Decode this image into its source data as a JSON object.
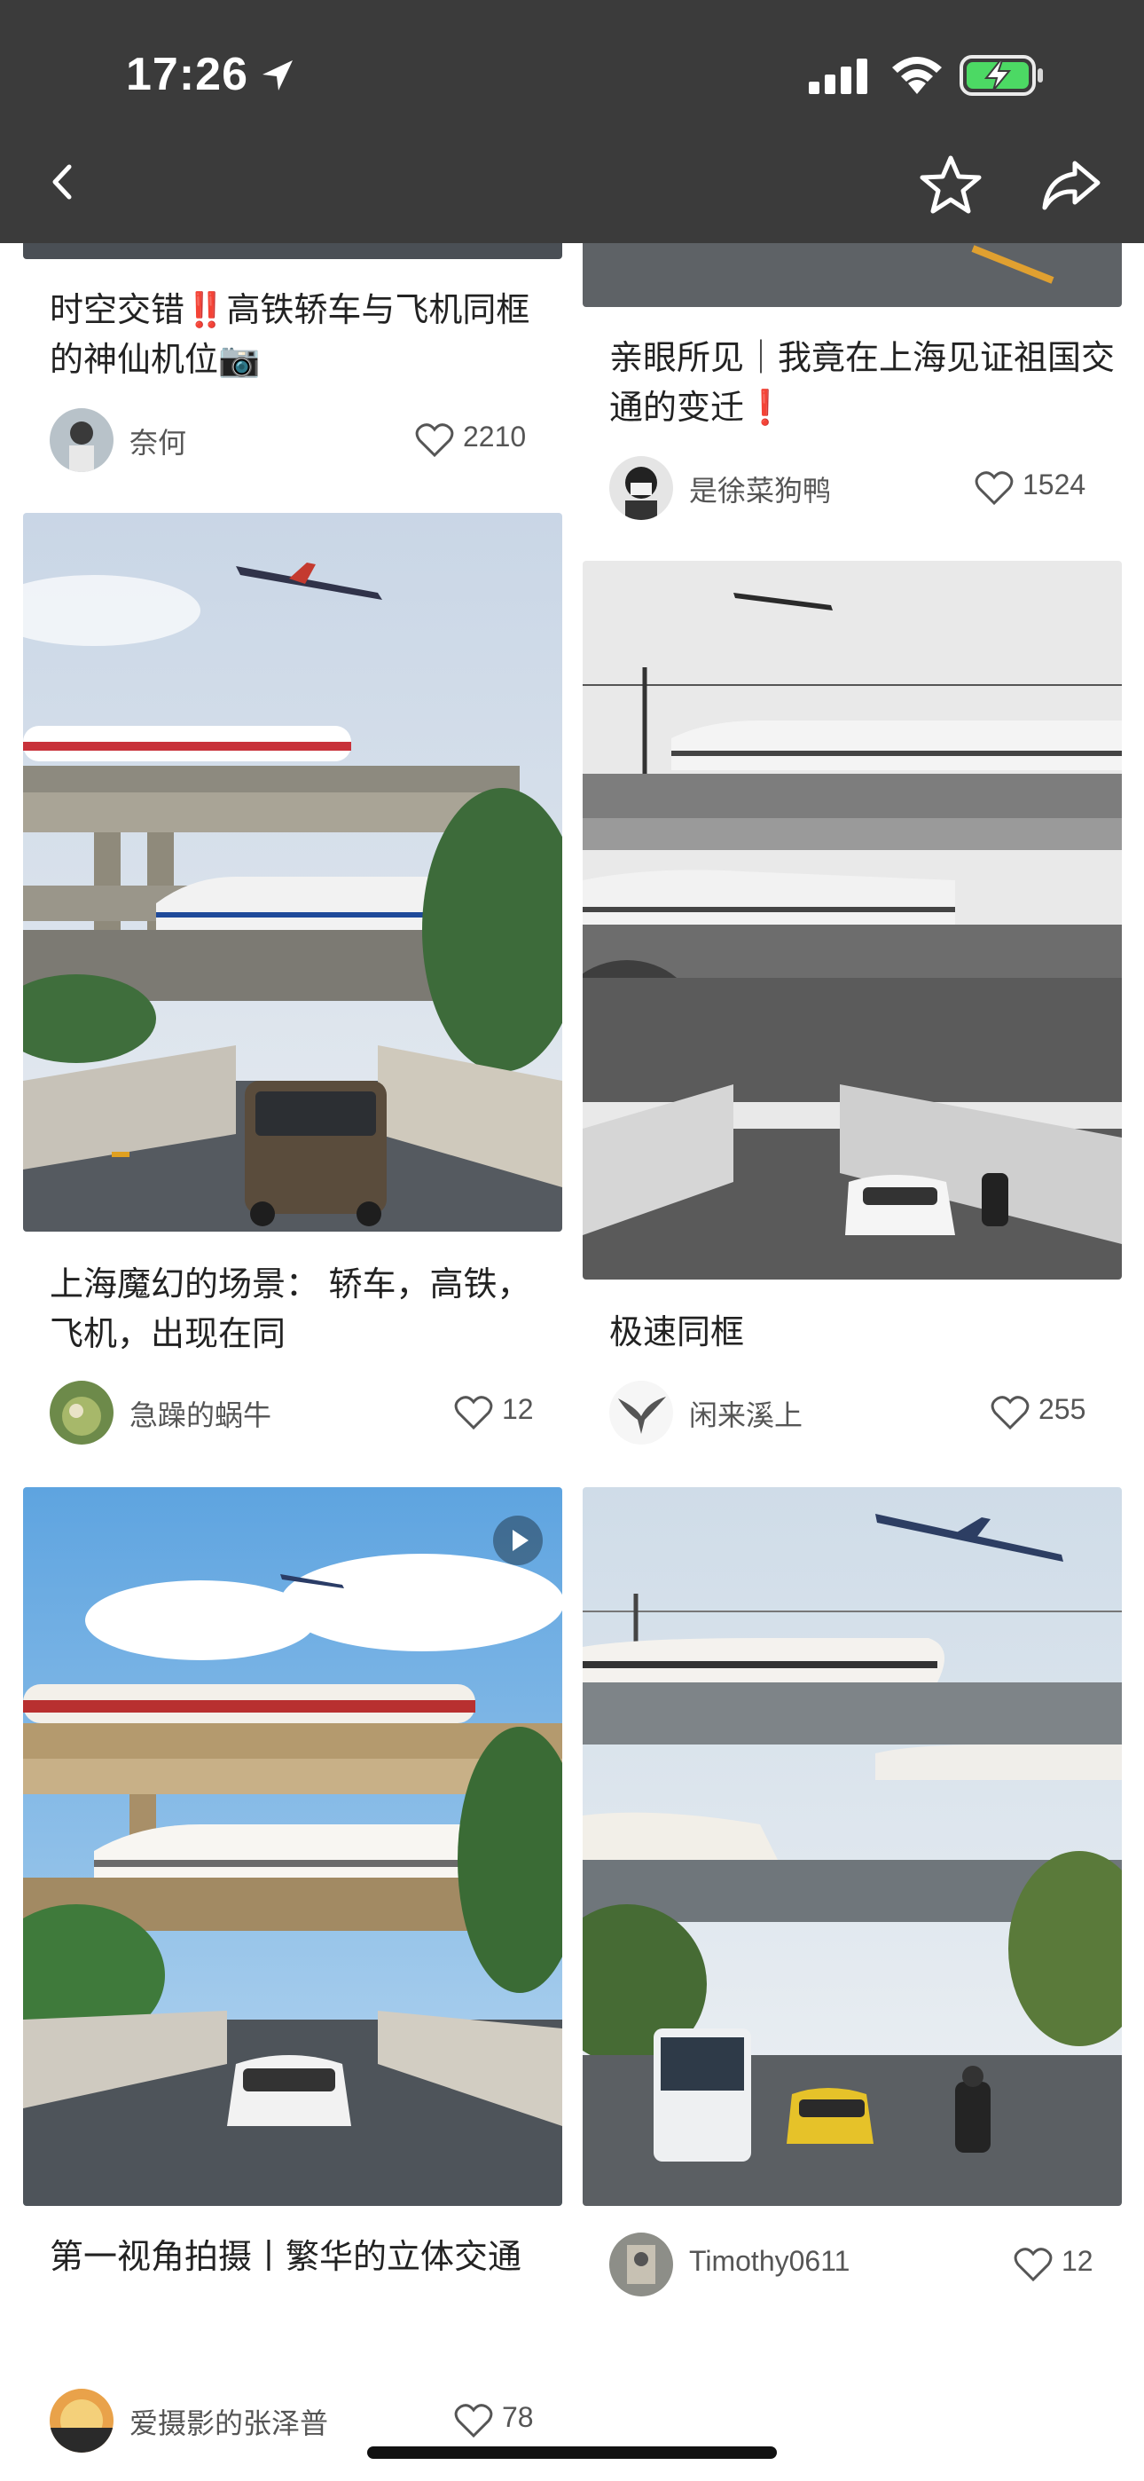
{
  "status_bar": {
    "time": "17:26"
  },
  "nav": {
    "back_icon": "chevron-left-icon",
    "favorite_icon": "star-icon",
    "share_icon": "share-icon"
  },
  "cards": [
    {
      "title_pre": "时空交错",
      "title_mark": "‼️",
      "title_post": "高铁轿车与飞机同框的神仙机位📷",
      "author": "奈何",
      "likes": "2210"
    },
    {
      "title_pre": "亲眼所见｜我竟在上海见证祖国交通的变迁",
      "title_mark": "❗",
      "title_post": "",
      "author": "是徐菜狗鸭",
      "likes": "1524"
    },
    {
      "title_pre": "上海魔幻的场景： 轿车，高铁，飞机，出现在同",
      "title_mark": "",
      "title_post": "",
      "author": "急躁的蜗牛",
      "likes": "12"
    },
    {
      "title_pre": "极速同框",
      "title_mark": "",
      "title_post": "",
      "author": "闲来溪上",
      "likes": "255"
    },
    {
      "title_pre": "第一视角拍摄丨繁华的立体交通",
      "title_mark": "",
      "title_post": "",
      "author": "爱摄影的张泽普",
      "likes": "78"
    },
    {
      "title_pre": "",
      "title_mark": "",
      "title_post": "",
      "author": "Timothy0611",
      "likes": "12"
    }
  ],
  "colors": {
    "header_bg": "#3b3b3b",
    "battery_green": "#4cd964",
    "text_main": "#222222",
    "text_muted": "#555555"
  }
}
